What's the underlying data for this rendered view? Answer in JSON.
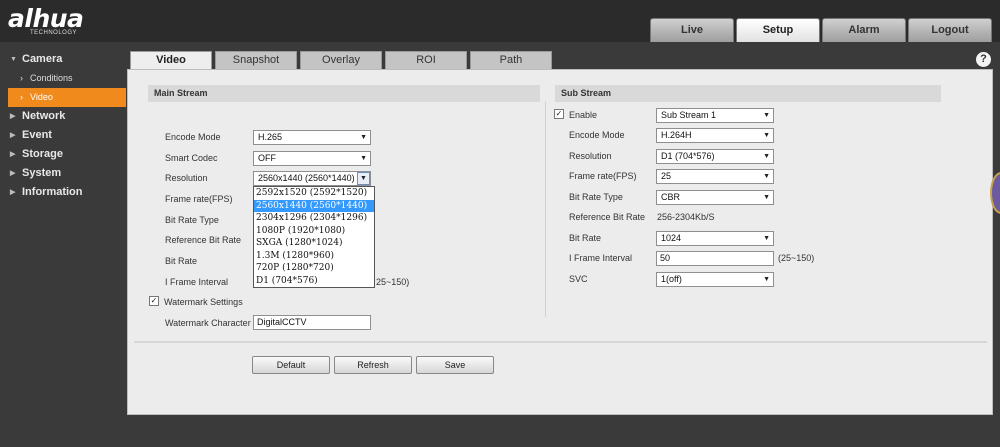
{
  "logo": {
    "text": "alhua",
    "subtext": "TECHNOLOGY"
  },
  "top_tabs": [
    {
      "label": "Live",
      "active": false
    },
    {
      "label": "Setup",
      "active": true
    },
    {
      "label": "Alarm",
      "active": false
    },
    {
      "label": "Logout",
      "active": false
    }
  ],
  "sidebar": {
    "camera": "Camera",
    "conditions": "Conditions",
    "video": "Video",
    "network": "Network",
    "event": "Event",
    "storage": "Storage",
    "system": "System",
    "information": "Information"
  },
  "help": "?",
  "content_tabs": [
    "Video",
    "Snapshot",
    "Overlay",
    "ROI",
    "Path"
  ],
  "main_stream": {
    "title": "Main Stream",
    "encode_mode": {
      "label": "Encode Mode",
      "value": "H.265"
    },
    "smart_codec": {
      "label": "Smart Codec",
      "value": "OFF"
    },
    "resolution": {
      "label": "Resolution",
      "value": "2560x1440 (2560*1440)"
    },
    "frame_rate": {
      "label": "Frame rate(FPS)"
    },
    "bit_rate_type": {
      "label": "Bit Rate Type"
    },
    "reference_bit_rate": {
      "label": "Reference Bit Rate"
    },
    "bit_rate": {
      "label": "Bit Rate"
    },
    "i_frame_interval": {
      "label": "I Frame Interval",
      "hint": "25~150)"
    },
    "watermark_settings": {
      "label": "Watermark Settings",
      "checked": true
    },
    "watermark_character": {
      "label": "Watermark Character",
      "value": "DigitalCCTV"
    }
  },
  "resolution_options": [
    "2592x1520 (2592*1520)",
    "2560x1440 (2560*1440)",
    "2304x1296 (2304*1296)",
    "1080P (1920*1080)",
    "SXGA (1280*1024)",
    "1.3M (1280*960)",
    "720P (1280*720)",
    "D1 (704*576)"
  ],
  "sub_stream": {
    "title": "Sub Stream",
    "enable": {
      "label": "Enable",
      "checked": true,
      "value": "Sub Stream 1"
    },
    "encode_mode": {
      "label": "Encode Mode",
      "value": "H.264H"
    },
    "resolution": {
      "label": "Resolution",
      "value": "D1 (704*576)"
    },
    "frame_rate": {
      "label": "Frame rate(FPS)",
      "value": "25"
    },
    "bit_rate_type": {
      "label": "Bit Rate Type",
      "value": "CBR"
    },
    "reference_bit_rate": {
      "label": "Reference Bit Rate",
      "value": "256-2304Kb/S"
    },
    "bit_rate": {
      "label": "Bit Rate",
      "value": "1024"
    },
    "i_frame_interval": {
      "label": "I Frame Interval",
      "value": "50",
      "hint": "(25~150)"
    },
    "svc": {
      "label": "SVC",
      "value": "1(off)"
    }
  },
  "buttons": {
    "default": "Default",
    "refresh": "Refresh",
    "save": "Save"
  }
}
